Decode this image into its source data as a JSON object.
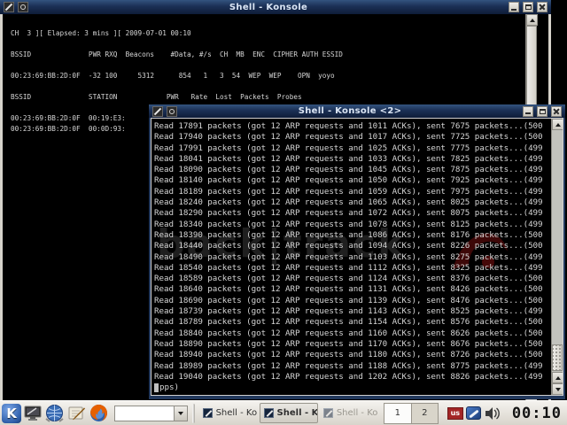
{
  "back_window": {
    "title": "Shell - Konsole",
    "lines": [
      "",
      "CH  3 ][ Elapsed: 3 mins ][ 2009-07-01 00:10",
      "",
      "BSSID              PWR RXQ  Beacons    #Data, #/s  CH  MB  ENC  CIPHER AUTH ESSID",
      "",
      "00:23:69:BB:2D:0F  -32 100     5312      854   1   3  54  WEP  WEP    OPN  yoyo",
      "",
      "BSSID              STATION            PWR   Rate  Lost  Packets  Probes",
      "",
      "00:23:69:BB:2D:0F  00:19:E3:",
      "00:23:69:BB:2D:0F  00:0D:93:"
    ]
  },
  "front_window": {
    "title": "Shell - Konsole <2>",
    "watermark": "back|track",
    "lines": [
      "Read 17891 packets (got 12 ARP requests and 1011 ACKs), sent 7675 packets...(500",
      "Read 17940 packets (got 12 ARP requests and 1017 ACKs), sent 7725 packets...(500",
      "Read 17991 packets (got 12 ARP requests and 1025 ACKs), sent 7775 packets...(499",
      "Read 18041 packets (got 12 ARP requests and 1033 ACKs), sent 7825 packets...(499",
      "Read 18090 packets (got 12 ARP requests and 1045 ACKs), sent 7875 packets...(499",
      "Read 18140 packets (got 12 ARP requests and 1050 ACKs), sent 7925 packets...(499",
      "Read 18189 packets (got 12 ARP requests and 1059 ACKs), sent 7975 packets...(499",
      "Read 18240 packets (got 12 ARP requests and 1065 ACKs), sent 8025 packets...(499",
      "Read 18290 packets (got 12 ARP requests and 1072 ACKs), sent 8075 packets...(499",
      "Read 18340 packets (got 12 ARP requests and 1078 ACKs), sent 8125 packets...(499",
      "Read 18390 packets (got 12 ARP requests and 1086 ACKs), sent 8176 packets...(500",
      "Read 18440 packets (got 12 ARP requests and 1094 ACKs), sent 8226 packets...(500",
      "Read 18490 packets (got 12 ARP requests and 1103 ACKs), sent 8275 packets...(499",
      "Read 18540 packets (got 12 ARP requests and 1112 ACKs), sent 8325 packets...(499",
      "Read 18589 packets (got 12 ARP requests and 1124 ACKs), sent 8376 packets...(500",
      "Read 18640 packets (got 12 ARP requests and 1131 ACKs), sent 8426 packets...(500",
      "Read 18690 packets (got 12 ARP requests and 1139 ACKs), sent 8476 packets...(500",
      "Read 18739 packets (got 12 ARP requests and 1143 ACKs), sent 8525 packets...(499",
      "Read 18789 packets (got 12 ARP requests and 1154 ACKs), sent 8576 packets...(500",
      "Read 18840 packets (got 12 ARP requests and 1160 ACKs), sent 8626 packets...(500",
      "Read 18890 packets (got 12 ARP requests and 1170 ACKs), sent 8676 packets...(500",
      "Read 18940 packets (got 12 ARP requests and 1180 ACKs), sent 8726 packets...(500",
      "Read 18989 packets (got 12 ARP requests and 1188 ACKs), sent 8775 packets...(499",
      "Read 19040 packets (got 12 ARP requests and 1202 ACKs), sent 8826 packets...(499"
    ],
    "prompt_line": "pps)"
  },
  "taskbar": {
    "kmenu_label": "K",
    "combo_value": "",
    "buttons": [
      {
        "label": "Shell - Konso",
        "state": "normal"
      },
      {
        "label": "Shell - Kon",
        "state": "active"
      },
      {
        "label": "Shell - Konso",
        "state": "dim"
      }
    ],
    "pager": [
      "1",
      "2"
    ],
    "tray": {
      "keyboard_layout": "us"
    },
    "clock": "00:10"
  },
  "colors": {
    "titlebar": "#1b3055",
    "terminal_bg": "#000000",
    "terminal_fg": "#d6d6d6",
    "taskbar_bg": "#d8d4cb",
    "keyboard_flag": "#a32626"
  }
}
